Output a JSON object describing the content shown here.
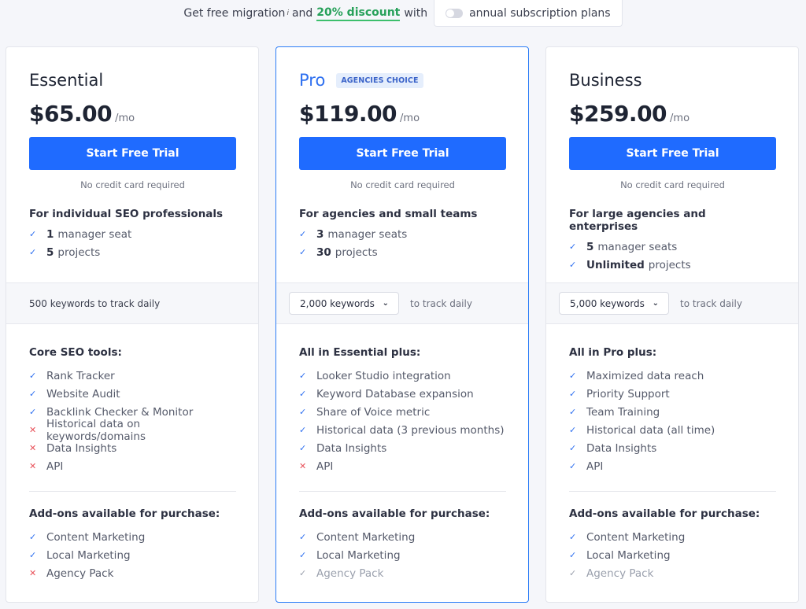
{
  "promo": {
    "prefix": "Get free migration",
    "info_mark": "i",
    "mid": "and",
    "discount": "20% discount",
    "suffix": "with",
    "toggle_label": "annual subscription plans",
    "toggle_on": false
  },
  "colors": {
    "accent": "#1f6bff",
    "discount": "#27a15a",
    "check": "#2d6ff0",
    "cross": "#e8525a",
    "muted": "#9aa0ad"
  },
  "plans": [
    {
      "name": "Essential",
      "badge": null,
      "price": "$65.00",
      "period": "/mo",
      "cta": "Start Free Trial",
      "note": "No credit card required",
      "audience": "For individual SEO professionals",
      "limits": [
        {
          "status": "yes",
          "num": "1",
          "label": "manager seat"
        },
        {
          "status": "yes",
          "num": "5",
          "label": "projects"
        }
      ],
      "keywords": {
        "text": "500 keywords to track daily",
        "selectable": false
      },
      "features_title": "Core SEO tools:",
      "features": [
        {
          "status": "yes",
          "label": "Rank Tracker"
        },
        {
          "status": "yes",
          "label": "Website Audit"
        },
        {
          "status": "yes",
          "label": "Backlink Checker & Monitor"
        },
        {
          "status": "no",
          "label": "Historical data on keywords/domains"
        },
        {
          "status": "no",
          "label": "Data Insights"
        },
        {
          "status": "no",
          "label": "API"
        }
      ],
      "addons_title": "Add-ons available for purchase:",
      "addons": [
        {
          "status": "yes",
          "label": "Content Marketing"
        },
        {
          "status": "yes",
          "label": "Local Marketing"
        },
        {
          "status": "no",
          "label": "Agency Pack"
        }
      ]
    },
    {
      "name": "Pro",
      "badge": "AGENCIES CHOICE",
      "price": "$119.00",
      "period": "/mo",
      "cta": "Start Free Trial",
      "note": "No credit card required",
      "audience": "For agencies and small teams",
      "limits": [
        {
          "status": "yes",
          "num": "3",
          "label": "manager seats"
        },
        {
          "status": "yes",
          "num": "30",
          "label": "projects"
        }
      ],
      "keywords": {
        "selected": "2,000 keywords",
        "suffix": "to track daily",
        "selectable": true
      },
      "features_title": "All in Essential plus:",
      "features": [
        {
          "status": "yes",
          "label": "Looker Studio integration"
        },
        {
          "status": "yes",
          "label": "Keyword Database expansion"
        },
        {
          "status": "yes",
          "label": "Share of Voice metric"
        },
        {
          "status": "yes",
          "label": "Historical data (3 previous months)"
        },
        {
          "status": "yes",
          "label": "Data Insights"
        },
        {
          "status": "no",
          "label": "API"
        }
      ],
      "addons_title": "Add-ons available for purchase:",
      "addons": [
        {
          "status": "yes",
          "label": "Content Marketing"
        },
        {
          "status": "yes",
          "label": "Local Marketing"
        },
        {
          "status": "muted",
          "label": "Agency Pack"
        }
      ]
    },
    {
      "name": "Business",
      "badge": null,
      "price": "$259.00",
      "period": "/mo",
      "cta": "Start Free Trial",
      "note": "No credit card required",
      "audience": "For large agencies and enterprises",
      "limits": [
        {
          "status": "yes",
          "num": "5",
          "label": "manager seats"
        },
        {
          "status": "yes",
          "num": "Unlimited",
          "label": "projects"
        }
      ],
      "keywords": {
        "selected": "5,000 keywords",
        "suffix": "to track daily",
        "selectable": true
      },
      "features_title": "All in Pro plus:",
      "features": [
        {
          "status": "yes",
          "label": "Maximized data reach"
        },
        {
          "status": "yes",
          "label": "Priority Support"
        },
        {
          "status": "yes",
          "label": "Team Training"
        },
        {
          "status": "yes",
          "label": "Historical data (all time)"
        },
        {
          "status": "yes",
          "label": "Data Insights"
        },
        {
          "status": "yes",
          "label": "API"
        }
      ],
      "addons_title": "Add-ons available for purchase:",
      "addons": [
        {
          "status": "yes",
          "label": "Content Marketing"
        },
        {
          "status": "yes",
          "label": "Local Marketing"
        },
        {
          "status": "muted",
          "label": "Agency Pack"
        }
      ]
    }
  ]
}
